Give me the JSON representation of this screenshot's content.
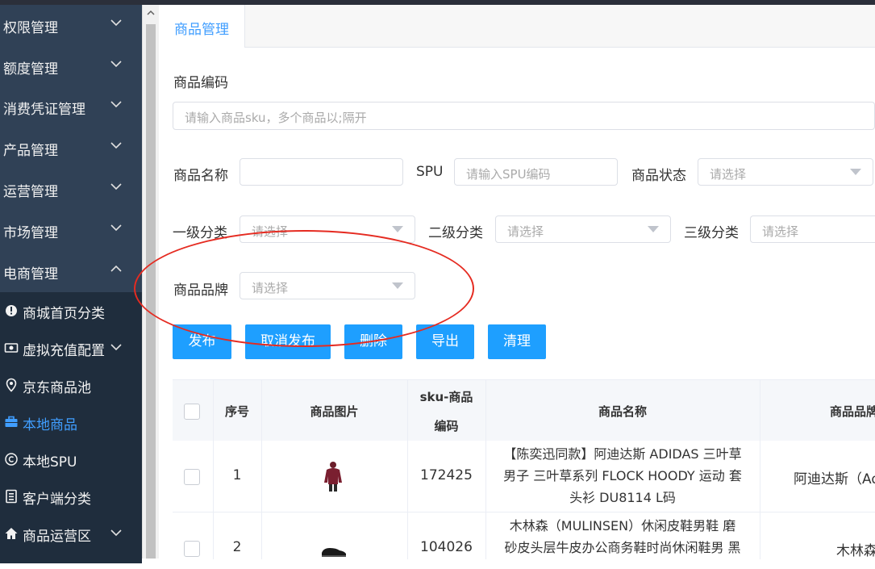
{
  "sidebar": {
    "items": [
      {
        "label": "权限管理",
        "expanded": false
      },
      {
        "label": "额度管理",
        "expanded": false
      },
      {
        "label": "消费凭证管理",
        "expanded": false
      },
      {
        "label": "产品管理",
        "expanded": false
      },
      {
        "label": "运营管理",
        "expanded": false
      },
      {
        "label": "市场管理",
        "expanded": false
      },
      {
        "label": "电商管理",
        "expanded": true
      }
    ],
    "subitems": [
      {
        "label": "商城首页分类",
        "icon": "info-circle-icon"
      },
      {
        "label": "虚拟充值配置",
        "icon": "card-icon"
      },
      {
        "label": "京东商品池",
        "icon": "location-pin-icon"
      },
      {
        "label": "本地商品",
        "icon": "briefcase-icon",
        "active": true
      },
      {
        "label": "本地SPU",
        "icon": "copyright-icon"
      },
      {
        "label": "客户端分类",
        "icon": "document-icon"
      },
      {
        "label": "商品运营区",
        "icon": "home-icon"
      }
    ],
    "active_color": "#409eff"
  },
  "tabs": {
    "active": "商品管理"
  },
  "form": {
    "code_label": "商品编码",
    "code_placeholder": "请输入商品sku，多个商品以;隔开",
    "name_label": "商品名称",
    "spu_label": "SPU",
    "spu_placeholder": "请输入SPU编码",
    "status_label": "商品状态",
    "status_placeholder": "请选择",
    "cat1_label": "一级分类",
    "cat1_placeholder": "请选择",
    "cat2_label": "二级分类",
    "cat2_placeholder": "请选择",
    "cat3_label": "三级分类",
    "cat3_placeholder": "请选择",
    "brand_label": "商品品牌",
    "brand_placeholder": "请选择"
  },
  "buttons": {
    "publish": "发布",
    "unpublish": "取消发布",
    "delete": "删除",
    "export": "导出",
    "clear": "清理",
    "color": "#1e9fff"
  },
  "table": {
    "headers": {
      "index": "序号",
      "image": "商品图片",
      "sku_line1": "sku-商品",
      "sku_line2": "编码",
      "name": "商品名称",
      "brand": "商品品牌"
    },
    "rows": [
      {
        "index": "1",
        "sku": "172425",
        "name_lines": [
          "【陈奕迅同款】阿迪达斯 ADIDAS 三叶草",
          "男子 三叶草系列 FLOCK HOODY 运动 套",
          "头衫 DU8114 L码"
        ],
        "brand": "阿迪达斯（Ad"
      },
      {
        "index": "2",
        "sku": "104026",
        "name_lines": [
          "木林森（MULINSEN）休闲皮鞋男鞋 磨",
          "砂皮头层牛皮办公商务鞋时尚休闲鞋男 黑"
        ],
        "brand": "木林森"
      }
    ]
  },
  "annotation_color": "#e52b21"
}
